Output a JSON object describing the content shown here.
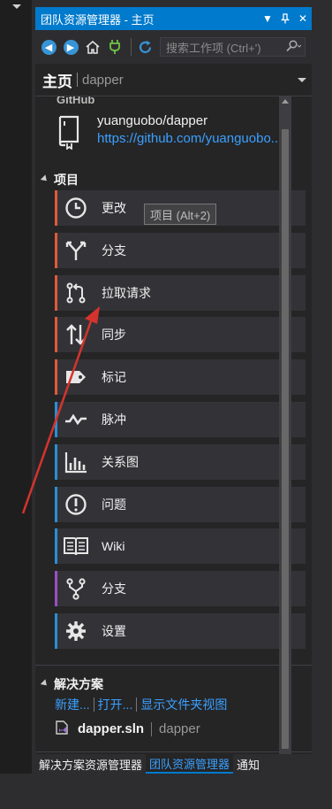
{
  "window": {
    "title": "团队资源管理器 - 主页",
    "menu_icon": "dropdown-caret-icon",
    "pin_icon": "pin-icon",
    "close_icon": "close-icon"
  },
  "toolbar": {
    "back_icon": "back-arrow-icon",
    "forward_icon": "forward-arrow-icon",
    "home_icon": "home-icon",
    "connect_icon": "plug-icon",
    "refresh_icon": "refresh-icon",
    "search_placeholder": "搜索工作项 (Ctrl+')",
    "search_icon": "search-icon"
  },
  "header": {
    "page": "主页",
    "repo": "dapper"
  },
  "github": {
    "label": "GitHub",
    "repo_name": "yuanguobo/dapper",
    "repo_url": "https://github.com/yuanguobo..."
  },
  "project_section": {
    "title": "项目",
    "tooltip": "项目 (Alt+2)",
    "items": [
      {
        "label": "更改",
        "icon": "clock-icon",
        "accent": "#e05a3a"
      },
      {
        "label": "分支",
        "icon": "branch-merge-icon",
        "accent": "#e05a3a"
      },
      {
        "label": "拉取请求",
        "icon": "pull-request-icon",
        "accent": "#e05a3a"
      },
      {
        "label": "同步",
        "icon": "sync-arrows-icon",
        "accent": "#e05a3a"
      },
      {
        "label": "标记",
        "icon": "tag-icon",
        "accent": "#e05a3a"
      },
      {
        "label": "脉冲",
        "icon": "pulse-icon",
        "accent": "#2a8fd6"
      },
      {
        "label": "关系图",
        "icon": "bar-graph-icon",
        "accent": "#2a8fd6"
      },
      {
        "label": "问题",
        "icon": "issue-icon",
        "accent": "#2a8fd6"
      },
      {
        "label": "Wiki",
        "icon": "book-icon",
        "accent": "#2a8fd6"
      },
      {
        "label": "分支",
        "icon": "fork-icon",
        "accent": "#9b4fc4"
      },
      {
        "label": "设置",
        "icon": "gear-icon",
        "accent": "#2a8fd6"
      }
    ]
  },
  "solution_section": {
    "title": "解决方案",
    "links": [
      "新建...",
      "打开...",
      "显示文件夹视图"
    ],
    "solution_file": "dapper.sln",
    "solution_project": "dapper"
  },
  "bottom_tabs": [
    {
      "label": "解决方案资源管理器",
      "active": false
    },
    {
      "label": "团队资源管理器",
      "active": true
    },
    {
      "label": "通知",
      "active": false
    }
  ]
}
